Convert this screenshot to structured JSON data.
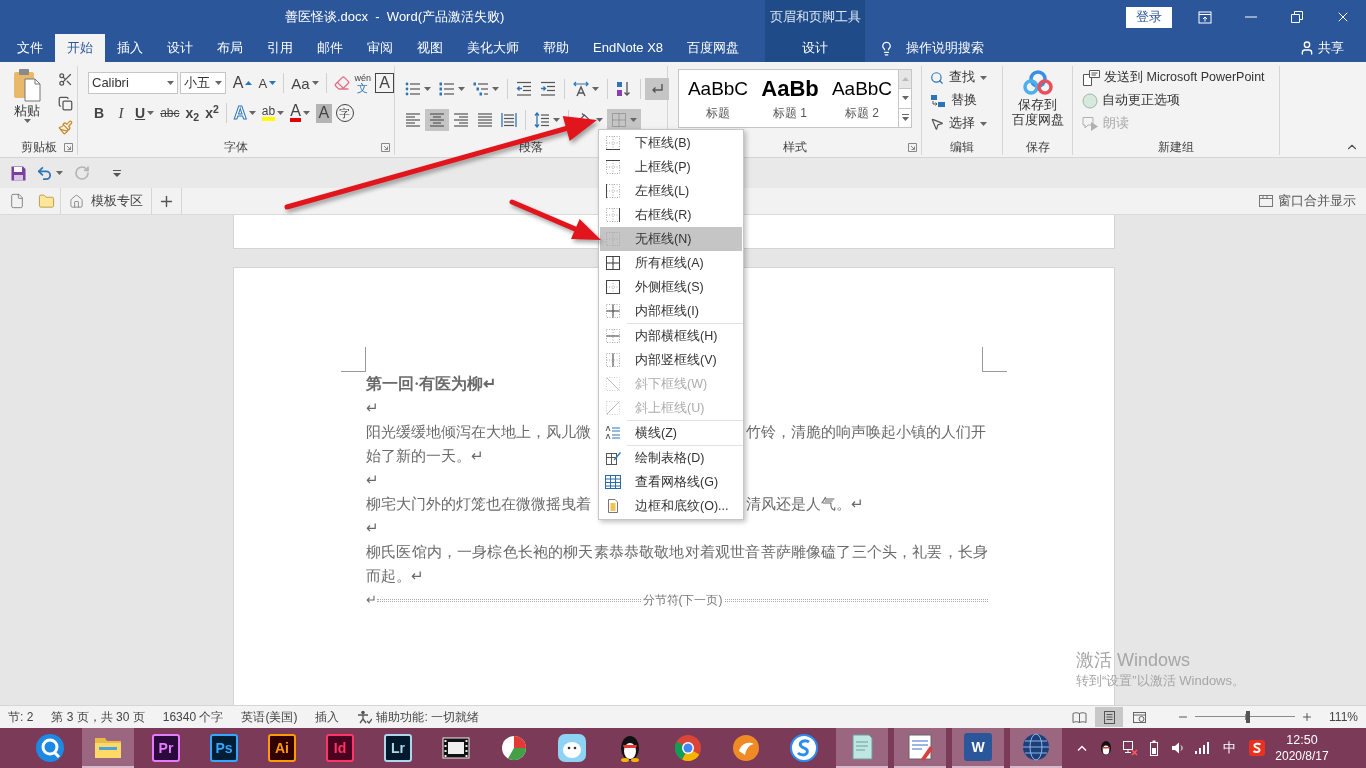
{
  "window": {
    "title": "善医怪谈.docx  -  Word(产品激活失败)",
    "tool_group": "页眉和页脚工具",
    "login": "登录"
  },
  "tabs": [
    {
      "label": "文件",
      "selected": false,
      "kind": "main"
    },
    {
      "label": "开始",
      "selected": true,
      "kind": "main"
    },
    {
      "label": "插入",
      "selected": false,
      "kind": "main"
    },
    {
      "label": "设计",
      "selected": false,
      "kind": "main"
    },
    {
      "label": "布局",
      "selected": false,
      "kind": "main"
    },
    {
      "label": "引用",
      "selected": false,
      "kind": "main"
    },
    {
      "label": "邮件",
      "selected": false,
      "kind": "main"
    },
    {
      "label": "审阅",
      "selected": false,
      "kind": "main"
    },
    {
      "label": "视图",
      "selected": false,
      "kind": "main"
    },
    {
      "label": "美化大师",
      "selected": false,
      "kind": "main"
    },
    {
      "label": "帮助",
      "selected": false,
      "kind": "main"
    },
    {
      "label": "EndNote X8",
      "selected": false,
      "kind": "main"
    },
    {
      "label": "百度网盘",
      "selected": false,
      "kind": "main"
    },
    {
      "label": "设计",
      "selected": false,
      "kind": "contextual"
    }
  ],
  "tell_me": "操作说明搜索",
  "share": "共享",
  "clipboard": {
    "title": "剪贴板",
    "paste": "粘贴"
  },
  "font": {
    "title": "字体",
    "name": "Calibri",
    "size": "小五",
    "row1": [
      {
        "kind": "grow",
        "glyph": "A"
      },
      {
        "kind": "shrink",
        "glyph": "A"
      },
      {
        "kind": "case",
        "glyph": "Aa"
      },
      {
        "kind": "clear"
      },
      {
        "kind": "phonetic",
        "glyph": "wén",
        "sub": "文"
      },
      {
        "kind": "boxed",
        "glyph": "A"
      }
    ],
    "row2": [
      {
        "kind": "bold",
        "glyph": "B"
      },
      {
        "kind": "italic",
        "glyph": "I"
      },
      {
        "kind": "underline",
        "glyph": "U"
      },
      {
        "kind": "strike",
        "glyph": "abc"
      },
      {
        "kind": "subscript",
        "glyph": "x$_{2}$"
      },
      {
        "kind": "superscript",
        "glyph": "x$^{2}$"
      },
      {
        "kind": "effects",
        "glyph": "A"
      },
      {
        "kind": "highlight",
        "glyph": "ab"
      },
      {
        "kind": "color",
        "glyph": "A"
      },
      {
        "kind": "shading",
        "glyph": "A"
      },
      {
        "kind": "enclose",
        "glyph": "字"
      }
    ]
  },
  "paragraph": {
    "title": "段落",
    "row1": [
      {
        "kind": "bullets",
        "selected": false
      },
      {
        "kind": "numbering",
        "selected": false
      },
      {
        "kind": "multilevel",
        "selected": false
      },
      {
        "kind": "outdent",
        "selected": false
      },
      {
        "kind": "indent",
        "selected": false
      },
      {
        "kind": "asian_layout",
        "selected": false
      },
      {
        "kind": "sort",
        "selected": false
      },
      {
        "kind": "show_marks",
        "selected": true
      }
    ],
    "row2": [
      {
        "kind": "align_left",
        "selected": false
      },
      {
        "kind": "align_center",
        "selected": true
      },
      {
        "kind": "align_right",
        "selected": false
      },
      {
        "kind": "justify",
        "selected": false
      },
      {
        "kind": "distribute",
        "selected": false
      },
      {
        "kind": "line_spacing",
        "selected": false
      },
      {
        "kind": "shading",
        "selected": false
      },
      {
        "kind": "borders",
        "selected": true
      }
    ]
  },
  "styles": {
    "title": "样式",
    "items": [
      {
        "kind": "title",
        "preview": "AaBbC",
        "name": "标题"
      },
      {
        "kind": "heading",
        "preview": "AaBb",
        "name": "标题 1"
      },
      {
        "kind": "subheading",
        "preview": "AaBbC",
        "name": "标题 2"
      }
    ]
  },
  "editing": {
    "title": "编辑",
    "items": [
      {
        "kind": "find",
        "label": "查找"
      },
      {
        "kind": "replace",
        "label": "替换"
      },
      {
        "kind": "select",
        "label": "选择"
      }
    ]
  },
  "save": {
    "title": "保存",
    "button_lines": [
      "保存到",
      "百度网盘"
    ]
  },
  "new_group": {
    "title": "新建组",
    "items": [
      {
        "kind": "send",
        "label": "发送到 Microsoft PowerPoint",
        "disabled": false
      },
      {
        "kind": "autocorrect",
        "label": "自动更正选项",
        "disabled": false
      },
      {
        "kind": "read_aloud",
        "label": "朗读",
        "disabled": true
      }
    ]
  },
  "quick_access": {
    "undo": {
      "disabled": false
    },
    "redo": {
      "disabled": true
    }
  },
  "doc_tabs": {
    "tabs": [
      {
        "label": "模板专区"
      }
    ],
    "merge": "窗口合并显示"
  },
  "border_menu": [
    {
      "kind": "bottom",
      "label": "下框线(B)",
      "selected": false,
      "disabled": false,
      "separator_before": false
    },
    {
      "kind": "top",
      "label": "上框线(P)",
      "selected": false,
      "disabled": false,
      "separator_before": false
    },
    {
      "kind": "left",
      "label": "左框线(L)",
      "selected": false,
      "disabled": false,
      "separator_before": false
    },
    {
      "kind": "right",
      "label": "右框线(R)",
      "selected": false,
      "disabled": false,
      "separator_before": false
    },
    {
      "kind": "none",
      "label": "无框线(N)",
      "selected": true,
      "disabled": false,
      "separator_before": false
    },
    {
      "kind": "all",
      "label": "所有框线(A)",
      "selected": false,
      "disabled": false,
      "separator_before": false
    },
    {
      "kind": "outside",
      "label": "外侧框线(S)",
      "selected": false,
      "disabled": false,
      "separator_before": false
    },
    {
      "kind": "inside",
      "label": "内部框线(I)",
      "selected": false,
      "disabled": false,
      "separator_before": false
    },
    {
      "kind": "inside_h",
      "label": "内部横框线(H)",
      "selected": false,
      "disabled": false,
      "separator_before": true
    },
    {
      "kind": "inside_v",
      "label": "内部竖框线(V)",
      "selected": false,
      "disabled": false,
      "separator_before": false
    },
    {
      "kind": "diag_down",
      "label": "斜下框线(W)",
      "selected": false,
      "disabled": true,
      "separator_before": false
    },
    {
      "kind": "diag_up",
      "label": "斜上框线(U)",
      "selected": false,
      "disabled": true,
      "separator_before": false
    },
    {
      "kind": "hline",
      "label": "横线(Z)",
      "selected": false,
      "disabled": false,
      "separator_before": true
    },
    {
      "kind": "draw",
      "label": "绘制表格(D)",
      "selected": false,
      "disabled": false,
      "separator_before": true
    },
    {
      "kind": "gridlines",
      "label": "查看网格线(G)",
      "selected": false,
      "disabled": false,
      "separator_before": false
    },
    {
      "kind": "borders_shading",
      "label": "边框和底纹(O)...",
      "selected": false,
      "disabled": false,
      "separator_before": false
    }
  ],
  "document": {
    "blocks": [
      {
        "kind": "heading",
        "text": "第一回·有医为柳↵"
      },
      {
        "kind": "empty",
        "text": "↵"
      },
      {
        "kind": "covered",
        "lines": [
          {
            "left": "阳光缓缓地倾泻在大地上，风儿微",
            "right": "竹铃，清脆的响声唤起小镇的人们开"
          },
          {
            "left": "始了新的一天。↵"
          }
        ]
      },
      {
        "kind": "empty",
        "text": "↵"
      },
      {
        "kind": "covered",
        "lines": [
          {
            "left": "柳宅大门外的灯笼也在微微摇曳着",
            "right": "清风还是人气。↵"
          }
        ]
      },
      {
        "kind": "empty",
        "text": "↵"
      },
      {
        "kind": "body",
        "text": "柳氏医馆内，一身棕色长袍的柳天素恭恭敬敬地对着观世音菩萨雕像磕了三个头，礼罢，长身而起。↵"
      },
      {
        "kind": "section_break",
        "mark": "↵",
        "text": "分节符(下一页)"
      }
    ]
  },
  "activation": {
    "title": "激活 Windows",
    "hint": "转到“设置”以激活 Windows。"
  },
  "status_bar": {
    "items": [
      "节: 2",
      "第 3 页，共 30 页",
      "16340 个字",
      "英语(美国)",
      "插入"
    ],
    "accessibility": "辅助功能: 一切就绪",
    "views": [
      {
        "kind": "read",
        "selected": false
      },
      {
        "kind": "print",
        "selected": true
      },
      {
        "kind": "web",
        "selected": false
      }
    ],
    "zoom": {
      "level": 0.53,
      "reading": "111%"
    }
  },
  "taskbar": {
    "apps": [
      {
        "kind": "browser",
        "open": false
      },
      {
        "kind": "explorer",
        "open": true
      },
      {
        "kind": "premiere",
        "label": "Pr",
        "open": false
      },
      {
        "kind": "photoshop",
        "label": "Ps",
        "open": false
      },
      {
        "kind": "illustrator",
        "label": "Ai",
        "open": false
      },
      {
        "kind": "indesign",
        "label": "Id",
        "open": false
      },
      {
        "kind": "lightroom",
        "label": "Lr",
        "open": false
      },
      {
        "kind": "video",
        "open": false
      },
      {
        "kind": "chart",
        "open": false
      },
      {
        "kind": "mascot",
        "open": false
      },
      {
        "kind": "qq",
        "open": false
      },
      {
        "kind": "chrome",
        "open": false
      },
      {
        "kind": "fox",
        "open": false
      },
      {
        "kind": "sogou",
        "open": false
      },
      {
        "kind": "notes",
        "open": true
      },
      {
        "kind": "tool",
        "open": true
      },
      {
        "kind": "word",
        "label": "W",
        "open": true
      },
      {
        "kind": "globe",
        "open": true
      }
    ],
    "tray": {
      "ime": "中",
      "time": "12:50",
      "date": "2020/8/17"
    }
  }
}
